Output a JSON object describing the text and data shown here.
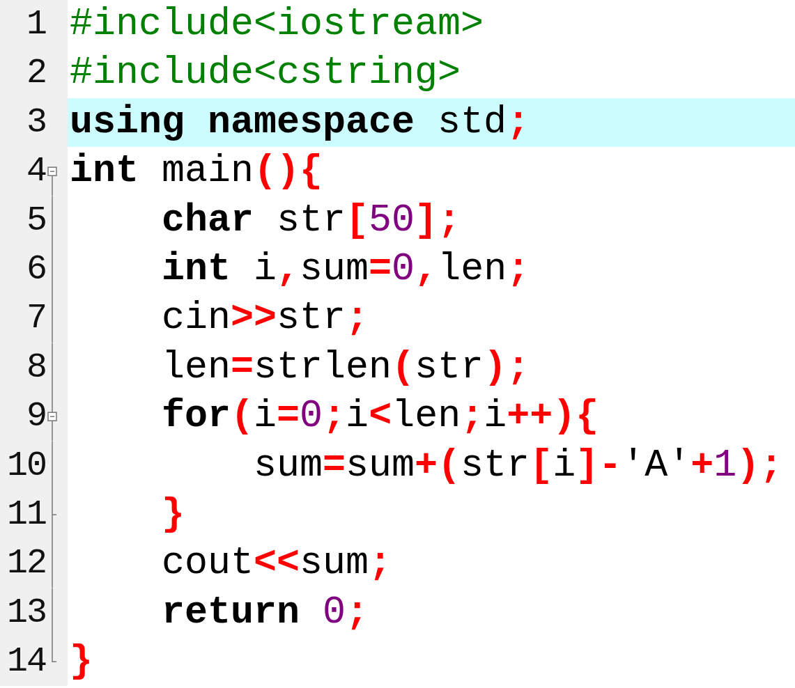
{
  "editor": {
    "lines": [
      {
        "number": "1",
        "current": false,
        "tokens": [
          {
            "text": "#include<iostream>",
            "kind": "preprocessor"
          }
        ]
      },
      {
        "number": "2",
        "current": false,
        "tokens": [
          {
            "text": "#include<cstring>",
            "kind": "preprocessor"
          }
        ]
      },
      {
        "number": "3",
        "current": true,
        "tokens": [
          {
            "text": "using namespace ",
            "kind": "keyword"
          },
          {
            "text": "std",
            "kind": "identifier"
          },
          {
            "text": ";",
            "kind": "operator"
          }
        ]
      },
      {
        "number": "4",
        "current": false,
        "fold": {
          "kind": "start"
        },
        "tokens": [
          {
            "text": "int ",
            "kind": "keyword"
          },
          {
            "text": "main",
            "kind": "identifier"
          },
          {
            "text": "(){",
            "kind": "operator"
          }
        ],
        "children": [
          {
            "number": "5",
            "current": false,
            "fold": {
              "kind": "body"
            },
            "tokens": [
              {
                "text": "char ",
                "kind": "keyword"
              },
              {
                "text": "str",
                "kind": "identifier"
              },
              {
                "text": "[",
                "kind": "operator"
              },
              {
                "text": "50",
                "kind": "number"
              },
              {
                "text": "];",
                "kind": "operator"
              }
            ]
          },
          {
            "number": "6",
            "current": false,
            "fold": {
              "kind": "body"
            },
            "tokens": [
              {
                "text": "int ",
                "kind": "keyword"
              },
              {
                "text": "i",
                "kind": "identifier"
              },
              {
                "text": ",",
                "kind": "operator"
              },
              {
                "text": "sum",
                "kind": "identifier"
              },
              {
                "text": "=",
                "kind": "operator"
              },
              {
                "text": "0",
                "kind": "number"
              },
              {
                "text": ",",
                "kind": "operator"
              },
              {
                "text": "len",
                "kind": "identifier"
              },
              {
                "text": ";",
                "kind": "operator"
              }
            ]
          },
          {
            "number": "7",
            "current": false,
            "fold": {
              "kind": "body"
            },
            "tokens": [
              {
                "text": "cin",
                "kind": "identifier"
              },
              {
                "text": ">>",
                "kind": "operator"
              },
              {
                "text": "str",
                "kind": "identifier"
              },
              {
                "text": ";",
                "kind": "operator"
              }
            ]
          },
          {
            "number": "8",
            "current": false,
            "fold": {
              "kind": "body"
            },
            "tokens": [
              {
                "text": "len",
                "kind": "identifier"
              },
              {
                "text": "=",
                "kind": "operator"
              },
              {
                "text": "strlen",
                "kind": "identifier"
              },
              {
                "text": "(",
                "kind": "operator"
              },
              {
                "text": "str",
                "kind": "identifier"
              },
              {
                "text": ");",
                "kind": "operator"
              }
            ]
          },
          {
            "number": "9",
            "current": false,
            "fold": {
              "kind": "start"
            },
            "tokens": [
              {
                "text": "for",
                "kind": "keyword"
              },
              {
                "text": "(",
                "kind": "operator"
              },
              {
                "text": "i",
                "kind": "identifier"
              },
              {
                "text": "=",
                "kind": "operator"
              },
              {
                "text": "0",
                "kind": "number"
              },
              {
                "text": ";",
                "kind": "operator"
              },
              {
                "text": "i",
                "kind": "identifier"
              },
              {
                "text": "<",
                "kind": "operator"
              },
              {
                "text": "len",
                "kind": "identifier"
              },
              {
                "text": ";",
                "kind": "operator"
              },
              {
                "text": "i",
                "kind": "identifier"
              },
              {
                "text": "++){",
                "kind": "operator"
              }
            ],
            "children": [
              {
                "number": "10",
                "current": false,
                "fold": {
                  "kind": "body"
                },
                "tokens": [
                  {
                    "text": "sum",
                    "kind": "identifier"
                  },
                  {
                    "text": "=",
                    "kind": "operator"
                  },
                  {
                    "text": "sum",
                    "kind": "identifier"
                  },
                  {
                    "text": "+(",
                    "kind": "operator"
                  },
                  {
                    "text": "str",
                    "kind": "identifier"
                  },
                  {
                    "text": "[",
                    "kind": "operator"
                  },
                  {
                    "text": "i",
                    "kind": "identifier"
                  },
                  {
                    "text": "]-",
                    "kind": "operator"
                  },
                  {
                    "text": "'A'",
                    "kind": "char"
                  },
                  {
                    "text": "+",
                    "kind": "operator"
                  },
                  {
                    "text": "1",
                    "kind": "number"
                  },
                  {
                    "text": ");",
                    "kind": "operator"
                  }
                ]
              }
            ]
          },
          {
            "number": "11",
            "current": false,
            "fold": {
              "kind": "inner_end"
            },
            "tokens": [
              {
                "text": "}",
                "kind": "operator"
              }
            ]
          },
          {
            "number": "12",
            "current": false,
            "fold": {
              "kind": "body"
            },
            "tokens": [
              {
                "text": "cout",
                "kind": "identifier"
              },
              {
                "text": "<<",
                "kind": "operator"
              },
              {
                "text": "sum",
                "kind": "identifier"
              },
              {
                "text": ";",
                "kind": "operator"
              }
            ]
          },
          {
            "number": "13",
            "current": false,
            "fold": {
              "kind": "body"
            },
            "tokens": [
              {
                "text": "return ",
                "kind": "keyword"
              },
              {
                "text": "0",
                "kind": "number"
              },
              {
                "text": ";",
                "kind": "operator"
              }
            ]
          }
        ]
      },
      {
        "number": "14",
        "current": false,
        "fold": {
          "kind": "end"
        },
        "tokens": [
          {
            "text": "}",
            "kind": "operator"
          }
        ]
      }
    ]
  }
}
